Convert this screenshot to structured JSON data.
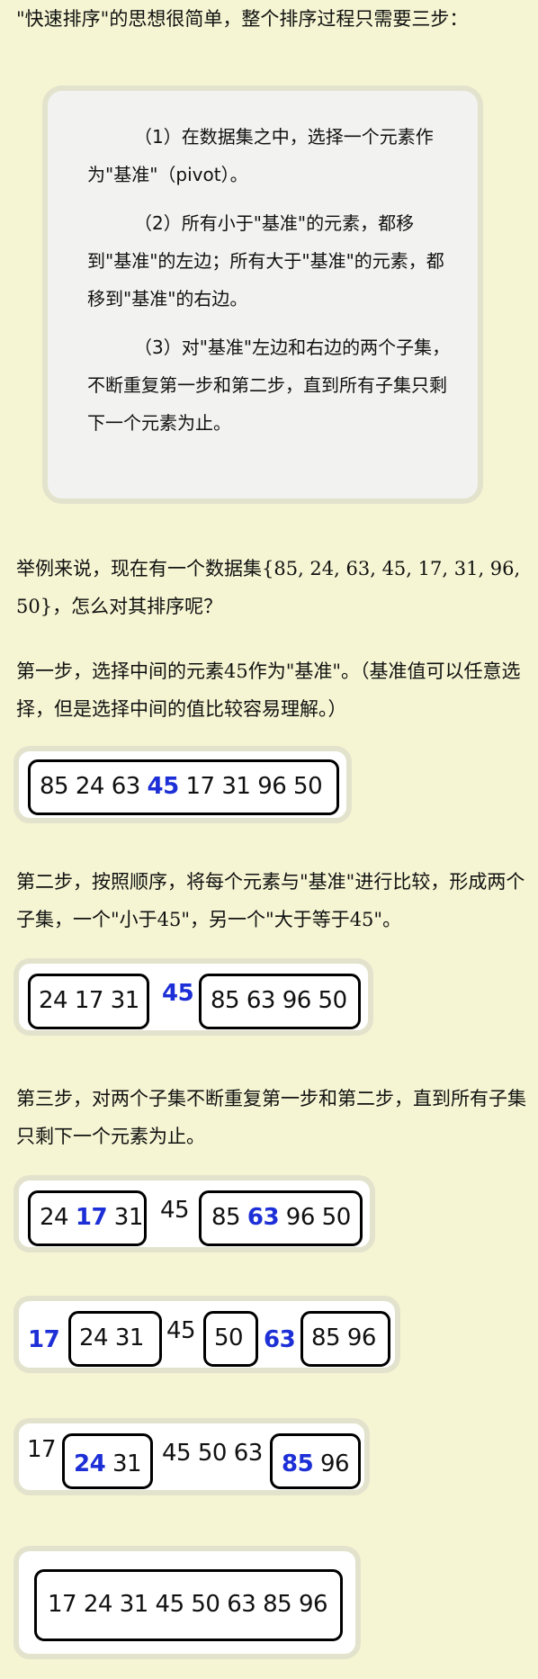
{
  "intro": "\"快速排序\"的思想很简单，整个排序过程只需要三步：",
  "steps": [
    "（1）在数据集之中，选择一个元素作为\"基准\"（pivot）。",
    "（2）所有小于\"基准\"的元素，都移到\"基准\"的左边；所有大于\"基准\"的元素，都移到\"基准\"的右边。",
    "（3）对\"基准\"左边和右边的两个子集，不断重复第一步和第二步，直到所有子集只剩下一个元素为止。"
  ],
  "example": "举例来说，现在有一个数据集{85, 24, 63, 45, 17, 31, 96, 50}，怎么对其排序呢？",
  "step1": "第一步，选择中间的元素45作为\"基准\"。（基准值可以任意选择，但是选择中间的值比较容易理解。）",
  "step2": "第二步，按照顺序，将每个元素与\"基准\"进行比较，形成两个子集，一个\"小于45\"，另一个\"大于等于45\"。",
  "step3": "第三步，对两个子集不断重复第一步和第二步，直到所有子集只剩下一个元素为止。",
  "diagrams": {
    "d1": {
      "a": "85 24 63 ",
      "pivot": "45",
      "b": " 17 31 96 50"
    },
    "d2": {
      "left": "24 17 31",
      "pivot": "45",
      "right": "85 63 96 50"
    },
    "d3": {
      "l1": "24 ",
      "lp": "17",
      "l2": " 31",
      "mid": "45",
      "r1": "85 ",
      "rp": "63",
      "r2": " 96 50"
    },
    "d4": {
      "p1": "17",
      "box1": "24 31",
      "mid": "45",
      "box2": "50",
      "p2": "63",
      "box3": "85 96"
    },
    "d5": {
      "a": "17",
      "bp": "24",
      "b2": " 31",
      "mid": "45 50 63",
      "cp": "85",
      "c2": " 96"
    },
    "d6": {
      "all": "17 24 31 45 50 63 85 96"
    }
  }
}
